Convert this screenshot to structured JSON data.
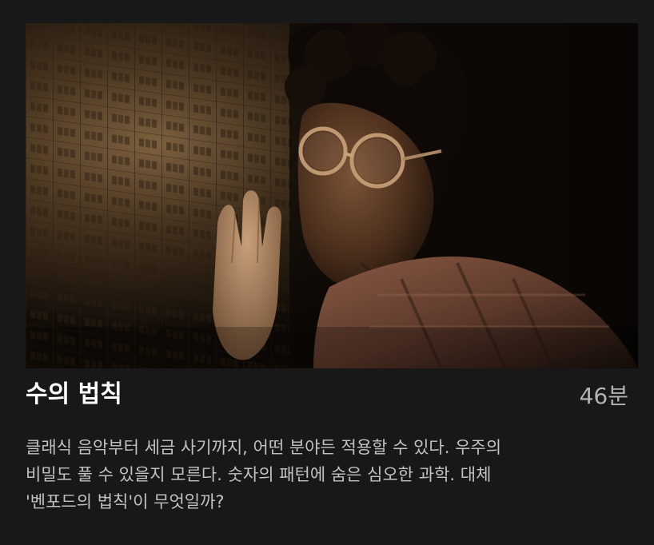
{
  "episode": {
    "title": "수의 법칙",
    "duration": "46분",
    "synopsis_lines": [
      "클래식 음악부터 세금 사기까지, 어떤 분야든 적용할 수 있다. 우주의",
      "비밀도 풀 수 있을지 모른다. 숫자의 패턴에 숨은 심오한 과학. 대체",
      "'벤포드의 법칙'이 무엇일까?"
    ]
  },
  "colors": {
    "background": "#181818",
    "title": "#ffffff",
    "duration": "#b3b3b3",
    "synopsis": "#c2c2c2"
  }
}
